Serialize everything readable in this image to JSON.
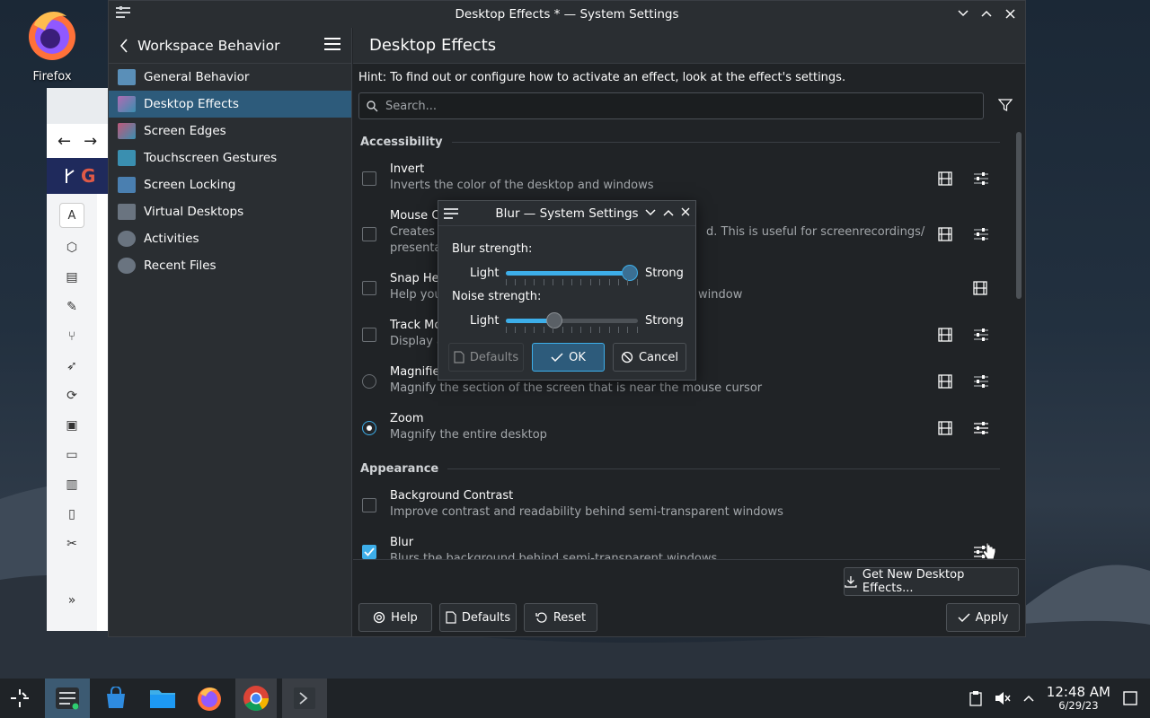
{
  "desktop": {
    "firefox_label": "Firefox"
  },
  "window": {
    "title": "Desktop Effects * — System Settings"
  },
  "sidebar": {
    "header": "Workspace Behavior",
    "items": [
      {
        "label": "General Behavior",
        "color": "#5a8fb8"
      },
      {
        "label": "Desktop Effects",
        "color": "#b06ab3"
      },
      {
        "label": "Screen Edges",
        "color": "#c0587a"
      },
      {
        "label": "Touchscreen Gestures",
        "color": "#3a8fb0"
      },
      {
        "label": "Screen Locking",
        "color": "#4a7fb0"
      },
      {
        "label": "Virtual Desktops",
        "color": "#6a7480"
      },
      {
        "label": "Activities",
        "color": "#6a7480"
      },
      {
        "label": "Recent Files",
        "color": "#6a7480"
      }
    ]
  },
  "content": {
    "title": "Desktop Effects",
    "hint": "Hint: To find out or configure how to activate an effect, look at the effect's settings.",
    "search_placeholder": "Search...",
    "sections": [
      {
        "name": "Accessibility"
      },
      {
        "name": "Appearance"
      }
    ],
    "effects": {
      "invert": {
        "name": "Invert",
        "desc": "Inverts the color of the desktop and windows"
      },
      "mouse_click": {
        "name": "Mouse C",
        "desc": "Creates a",
        "desc_right": "d. This is useful for screenrecordings/",
        "desc2": "presenta"
      },
      "snap_helper": {
        "name": "Snap Hel",
        "desc": "Help you",
        "desc_right": "window"
      },
      "track_mouse": {
        "name": "Track Mo",
        "desc": "Display a"
      },
      "magnifier": {
        "name": "Magnifie",
        "desc": "Magnify the section of the screen that is near the mouse cursor"
      },
      "zoom": {
        "name": "Zoom",
        "desc": "Magnify the entire desktop"
      },
      "background_contrast": {
        "name": "Background Contrast",
        "desc": "Improve contrast and readability behind semi-transparent windows"
      },
      "blur": {
        "name": "Blur",
        "desc": "Blurs the background behind semi-transparent windows"
      }
    }
  },
  "footer": {
    "get_new": "Get New Desktop Effects...",
    "help": "Help",
    "defaults": "Defaults",
    "reset": "Reset",
    "apply": "Apply"
  },
  "dialog": {
    "title": "Blur — System Settings",
    "blur_strength_label": "Blur strength:",
    "noise_strength_label": "Noise strength:",
    "light": "Light",
    "strong": "Strong",
    "blur_strength_value": 0.94,
    "noise_strength_value": 0.37,
    "defaults": "Defaults",
    "ok": "OK",
    "cancel": "Cancel"
  },
  "taskbar": {
    "time": "12:48 AM",
    "date": "6/29/23"
  }
}
